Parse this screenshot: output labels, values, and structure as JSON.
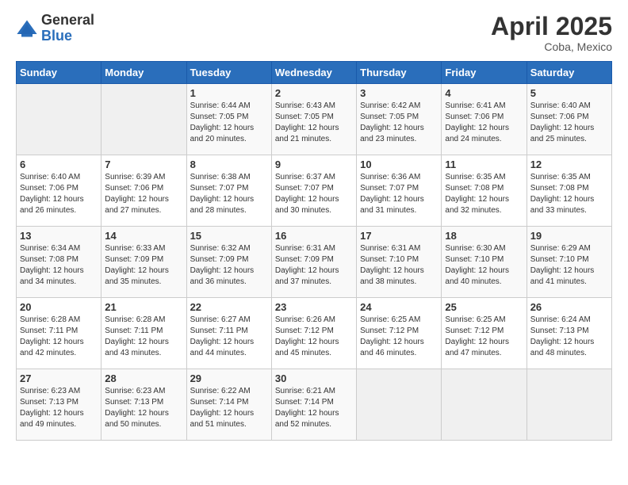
{
  "logo": {
    "general": "General",
    "blue": "Blue"
  },
  "header": {
    "title": "April 2025",
    "subtitle": "Coba, Mexico"
  },
  "weekdays": [
    "Sunday",
    "Monday",
    "Tuesday",
    "Wednesday",
    "Thursday",
    "Friday",
    "Saturday"
  ],
  "rows": [
    [
      {
        "day": "",
        "empty": true
      },
      {
        "day": "",
        "empty": true
      },
      {
        "day": "1",
        "sunrise": "Sunrise: 6:44 AM",
        "sunset": "Sunset: 7:05 PM",
        "daylight": "Daylight: 12 hours and 20 minutes."
      },
      {
        "day": "2",
        "sunrise": "Sunrise: 6:43 AM",
        "sunset": "Sunset: 7:05 PM",
        "daylight": "Daylight: 12 hours and 21 minutes."
      },
      {
        "day": "3",
        "sunrise": "Sunrise: 6:42 AM",
        "sunset": "Sunset: 7:05 PM",
        "daylight": "Daylight: 12 hours and 23 minutes."
      },
      {
        "day": "4",
        "sunrise": "Sunrise: 6:41 AM",
        "sunset": "Sunset: 7:06 PM",
        "daylight": "Daylight: 12 hours and 24 minutes."
      },
      {
        "day": "5",
        "sunrise": "Sunrise: 6:40 AM",
        "sunset": "Sunset: 7:06 PM",
        "daylight": "Daylight: 12 hours and 25 minutes."
      }
    ],
    [
      {
        "day": "6",
        "sunrise": "Sunrise: 6:40 AM",
        "sunset": "Sunset: 7:06 PM",
        "daylight": "Daylight: 12 hours and 26 minutes."
      },
      {
        "day": "7",
        "sunrise": "Sunrise: 6:39 AM",
        "sunset": "Sunset: 7:06 PM",
        "daylight": "Daylight: 12 hours and 27 minutes."
      },
      {
        "day": "8",
        "sunrise": "Sunrise: 6:38 AM",
        "sunset": "Sunset: 7:07 PM",
        "daylight": "Daylight: 12 hours and 28 minutes."
      },
      {
        "day": "9",
        "sunrise": "Sunrise: 6:37 AM",
        "sunset": "Sunset: 7:07 PM",
        "daylight": "Daylight: 12 hours and 30 minutes."
      },
      {
        "day": "10",
        "sunrise": "Sunrise: 6:36 AM",
        "sunset": "Sunset: 7:07 PM",
        "daylight": "Daylight: 12 hours and 31 minutes."
      },
      {
        "day": "11",
        "sunrise": "Sunrise: 6:35 AM",
        "sunset": "Sunset: 7:08 PM",
        "daylight": "Daylight: 12 hours and 32 minutes."
      },
      {
        "day": "12",
        "sunrise": "Sunrise: 6:35 AM",
        "sunset": "Sunset: 7:08 PM",
        "daylight": "Daylight: 12 hours and 33 minutes."
      }
    ],
    [
      {
        "day": "13",
        "sunrise": "Sunrise: 6:34 AM",
        "sunset": "Sunset: 7:08 PM",
        "daylight": "Daylight: 12 hours and 34 minutes."
      },
      {
        "day": "14",
        "sunrise": "Sunrise: 6:33 AM",
        "sunset": "Sunset: 7:09 PM",
        "daylight": "Daylight: 12 hours and 35 minutes."
      },
      {
        "day": "15",
        "sunrise": "Sunrise: 6:32 AM",
        "sunset": "Sunset: 7:09 PM",
        "daylight": "Daylight: 12 hours and 36 minutes."
      },
      {
        "day": "16",
        "sunrise": "Sunrise: 6:31 AM",
        "sunset": "Sunset: 7:09 PM",
        "daylight": "Daylight: 12 hours and 37 minutes."
      },
      {
        "day": "17",
        "sunrise": "Sunrise: 6:31 AM",
        "sunset": "Sunset: 7:10 PM",
        "daylight": "Daylight: 12 hours and 38 minutes."
      },
      {
        "day": "18",
        "sunrise": "Sunrise: 6:30 AM",
        "sunset": "Sunset: 7:10 PM",
        "daylight": "Daylight: 12 hours and 40 minutes."
      },
      {
        "day": "19",
        "sunrise": "Sunrise: 6:29 AM",
        "sunset": "Sunset: 7:10 PM",
        "daylight": "Daylight: 12 hours and 41 minutes."
      }
    ],
    [
      {
        "day": "20",
        "sunrise": "Sunrise: 6:28 AM",
        "sunset": "Sunset: 7:11 PM",
        "daylight": "Daylight: 12 hours and 42 minutes."
      },
      {
        "day": "21",
        "sunrise": "Sunrise: 6:28 AM",
        "sunset": "Sunset: 7:11 PM",
        "daylight": "Daylight: 12 hours and 43 minutes."
      },
      {
        "day": "22",
        "sunrise": "Sunrise: 6:27 AM",
        "sunset": "Sunset: 7:11 PM",
        "daylight": "Daylight: 12 hours and 44 minutes."
      },
      {
        "day": "23",
        "sunrise": "Sunrise: 6:26 AM",
        "sunset": "Sunset: 7:12 PM",
        "daylight": "Daylight: 12 hours and 45 minutes."
      },
      {
        "day": "24",
        "sunrise": "Sunrise: 6:25 AM",
        "sunset": "Sunset: 7:12 PM",
        "daylight": "Daylight: 12 hours and 46 minutes."
      },
      {
        "day": "25",
        "sunrise": "Sunrise: 6:25 AM",
        "sunset": "Sunset: 7:12 PM",
        "daylight": "Daylight: 12 hours and 47 minutes."
      },
      {
        "day": "26",
        "sunrise": "Sunrise: 6:24 AM",
        "sunset": "Sunset: 7:13 PM",
        "daylight": "Daylight: 12 hours and 48 minutes."
      }
    ],
    [
      {
        "day": "27",
        "sunrise": "Sunrise: 6:23 AM",
        "sunset": "Sunset: 7:13 PM",
        "daylight": "Daylight: 12 hours and 49 minutes."
      },
      {
        "day": "28",
        "sunrise": "Sunrise: 6:23 AM",
        "sunset": "Sunset: 7:13 PM",
        "daylight": "Daylight: 12 hours and 50 minutes."
      },
      {
        "day": "29",
        "sunrise": "Sunrise: 6:22 AM",
        "sunset": "Sunset: 7:14 PM",
        "daylight": "Daylight: 12 hours and 51 minutes."
      },
      {
        "day": "30",
        "sunrise": "Sunrise: 6:21 AM",
        "sunset": "Sunset: 7:14 PM",
        "daylight": "Daylight: 12 hours and 52 minutes."
      },
      {
        "day": "",
        "empty": true
      },
      {
        "day": "",
        "empty": true
      },
      {
        "day": "",
        "empty": true
      }
    ]
  ]
}
